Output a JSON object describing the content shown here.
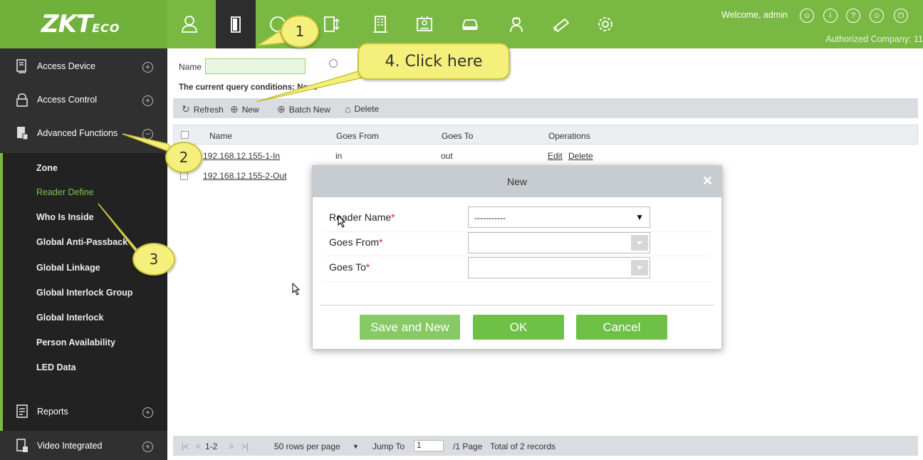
{
  "header": {
    "logo": "ZKT",
    "logo_suffix": "ECO",
    "welcome": "Welcome, admin",
    "company": "Authorized Company: 11"
  },
  "modules": [
    "personnel-icon",
    "access-door-icon",
    "attendance-icon",
    "elevator-icon",
    "building-icon",
    "visitor-icon",
    "parking-icon",
    "patrol-icon",
    "video-icon",
    "system-settings-icon"
  ],
  "sidebar": {
    "sections": [
      {
        "label": "Access Device",
        "toggle": "+"
      },
      {
        "label": "Access Control",
        "toggle": "+"
      },
      {
        "label": "Advanced Functions",
        "toggle": "−"
      }
    ],
    "submenu": [
      "Zone",
      "Reader Define",
      "Who Is Inside",
      "Global Anti-Passback",
      "Global Linkage",
      "Global Interlock Group",
      "Global Interlock",
      "Person Availability",
      "LED Data"
    ],
    "bottom_sections": [
      {
        "label": "Reports",
        "toggle": "+"
      },
      {
        "label": "Video Integrated",
        "toggle": "+"
      }
    ]
  },
  "filter": {
    "label": "Name",
    "value": ""
  },
  "query_text": "The current query conditions: None",
  "toolbar": {
    "refresh": "Refresh",
    "new": "New",
    "batch_new": "Batch New",
    "delete": "Delete"
  },
  "grid": {
    "columns": [
      "Name",
      "Goes From",
      "Goes To",
      "Operations"
    ],
    "rows": [
      {
        "name": "192.168.12.155-1-In",
        "goes_from": "in",
        "goes_to": "out",
        "edit": "Edit",
        "delete": "Delete"
      },
      {
        "name": "192.168.12.155-2-Out",
        "goes_from": "",
        "goes_to": "",
        "edit": "",
        "delete": ""
      }
    ]
  },
  "pager": {
    "range": "1-2",
    "rows_per_page": "50 rows per page",
    "jump_label": "Jump To",
    "jump_value": "1",
    "pages": "/1 Page",
    "total": "Total of 2 records"
  },
  "dialog": {
    "title": "New",
    "fields": [
      {
        "label": "Reader Name",
        "value": "-----------"
      },
      {
        "label": "Goes From",
        "value": ""
      },
      {
        "label": "Goes To",
        "value": ""
      }
    ],
    "save_new": "Save and New",
    "ok": "OK",
    "cancel": "Cancel"
  },
  "callouts": {
    "one": "1",
    "two": "2",
    "three": "3",
    "four": "4. Click here"
  },
  "colors": {
    "brand_green": "#79b943",
    "sidebar_bg": "#303030",
    "button_green": "#6ec047",
    "callout_yellow": "#f5f07c"
  }
}
